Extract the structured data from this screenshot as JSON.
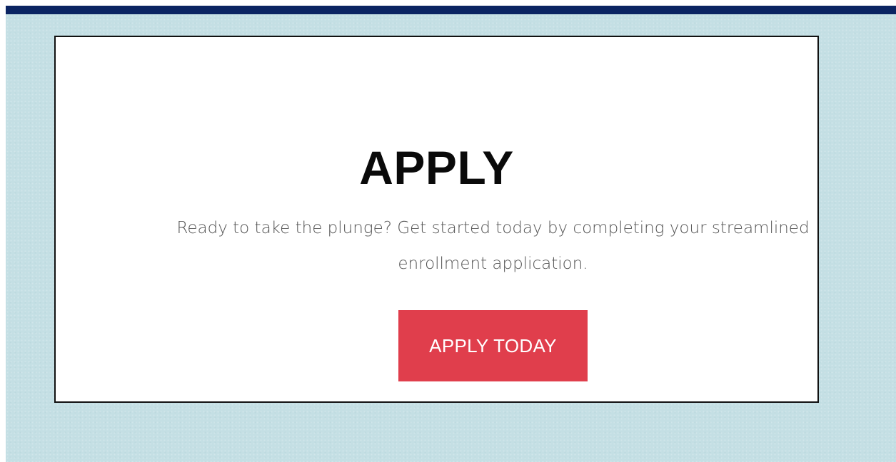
{
  "header": {
    "bar_color": "#0b2462"
  },
  "background": {
    "color": "#c4dfe4"
  },
  "card": {
    "title": "APPLY",
    "description": "Ready to take the plunge? Get started today by completing your streamlined enrollment application.",
    "button_label": "APPLY TODAY",
    "button_color": "#e03e4c"
  }
}
